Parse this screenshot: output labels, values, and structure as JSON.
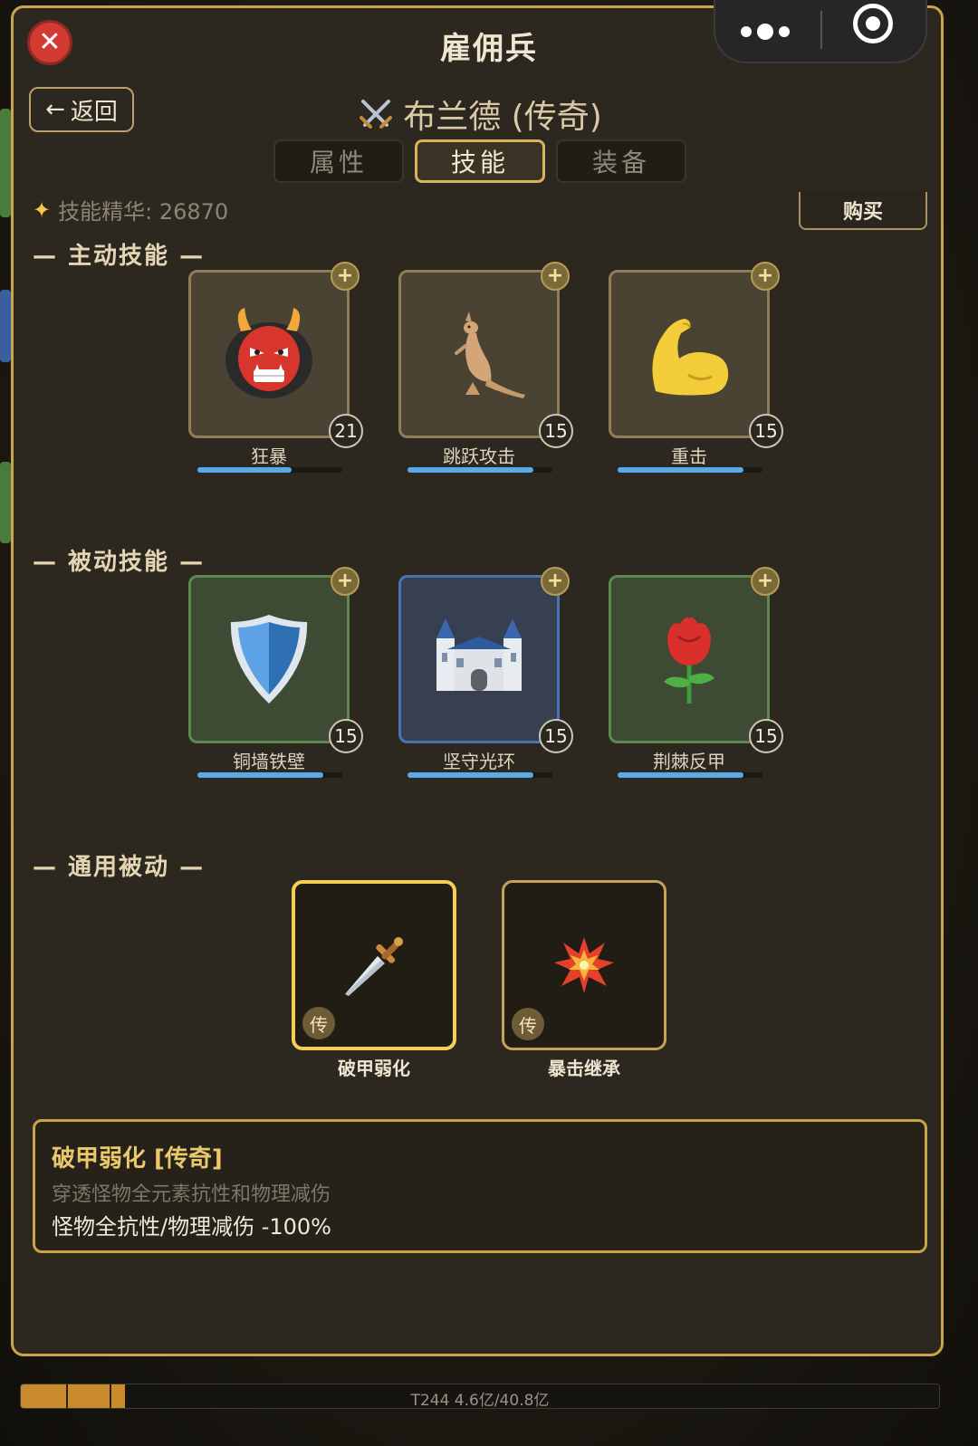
{
  "panel": {
    "title": "雇佣兵"
  },
  "nav": {
    "back_label": "返回"
  },
  "hero": {
    "name": "布兰德 (传奇)",
    "icon": "crossed-swords-icon"
  },
  "tabs": [
    {
      "label": "属性",
      "active": false
    },
    {
      "label": "技能",
      "active": true
    },
    {
      "label": "装备",
      "active": false
    }
  ],
  "essence": {
    "label": "技能精华: 26870",
    "icon": "sparkles-icon"
  },
  "buy_label": "购买",
  "sections": {
    "active": "— 主动技能 —",
    "passive": "— 被动技能 —",
    "general": "— 通用被动 —"
  },
  "active_skills": [
    {
      "name": "狂暴",
      "level": "21",
      "progress": 0.65,
      "icon": "oni-mask-icon"
    },
    {
      "name": "跳跃攻击",
      "level": "15",
      "progress": 0.87,
      "icon": "kangaroo-icon"
    },
    {
      "name": "重击",
      "level": "15",
      "progress": 0.87,
      "icon": "flexed-biceps-icon"
    }
  ],
  "passive_skills": [
    {
      "name": "铜墙铁壁",
      "level": "15",
      "progress": 0.87,
      "icon": "shield-icon"
    },
    {
      "name": "坚守光环",
      "level": "15",
      "progress": 0.87,
      "icon": "castle-icon"
    },
    {
      "name": "荆棘反甲",
      "level": "15",
      "progress": 0.87,
      "icon": "rose-icon"
    }
  ],
  "general_passives": [
    {
      "name": "破甲弱化",
      "badge": "传",
      "selected": true,
      "icon": "dagger-icon"
    },
    {
      "name": "暴击继承",
      "badge": "传",
      "selected": false,
      "icon": "explosion-icon"
    }
  ],
  "detail": {
    "title": "破甲弱化 [传奇]",
    "description": "穿透怪物全元素抗性和物理减伤",
    "stat": "怪物全抗性/物理减伤 -100%"
  },
  "bottom_bar": {
    "text": "T244  4.6亿/40.8亿",
    "progress": 0.113
  },
  "colors": {
    "accent_gold": "#d8b55a",
    "progress_blue": "#58a9e8",
    "close_red": "#d33a32"
  }
}
